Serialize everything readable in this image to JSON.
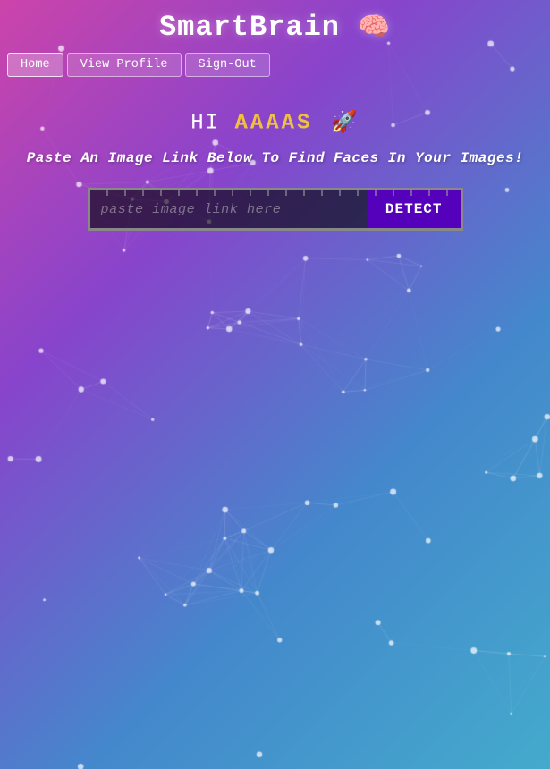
{
  "app": {
    "title": "SmartBrain",
    "brain_emoji": "🧠"
  },
  "nav": {
    "home_label": "Home",
    "view_profile_label": "View Profile",
    "sign_out_label": "Sign-Out"
  },
  "main": {
    "greeting_prefix": "Hi ",
    "username": "AAAAS",
    "rocket_emoji": "🚀",
    "subtitle": "Paste An Image Link Below To Find Faces In Your Images!",
    "input_placeholder": "paste image link here",
    "detect_label": "DETECT"
  },
  "colors": {
    "accent_purple": "#5500bb",
    "username_color": "#f0c040"
  }
}
